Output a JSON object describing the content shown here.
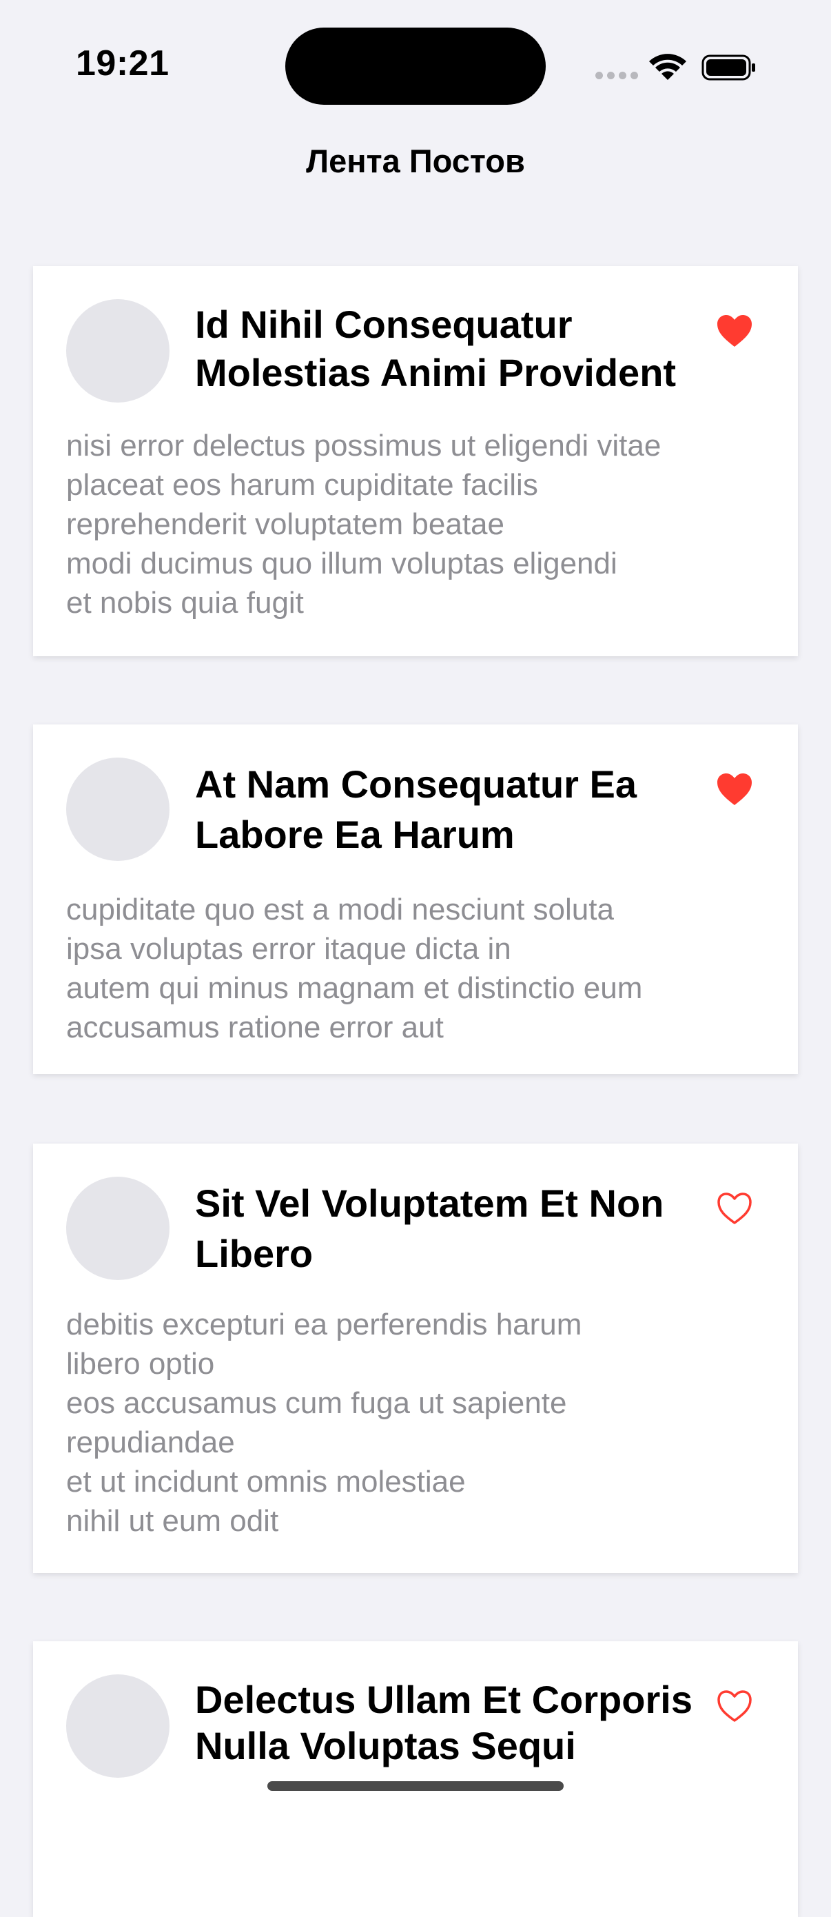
{
  "status_bar": {
    "time": "19:21"
  },
  "nav": {
    "title": "Лента Постов"
  },
  "colors": {
    "background": "#f2f2f7",
    "card": "#ffffff",
    "like_red": "#ff3b30",
    "body_text": "#8e8e93",
    "avatar": "#e5e5ea"
  },
  "posts": [
    {
      "title": "Id Nihil Consequatur Molestias Animi Provident",
      "body": "nisi error delectus possimus ut eligendi vitae\nplaceat eos harum cupiditate facilis\nreprehenderit voluptatem beatae\nmodi ducimus quo illum voluptas eligendi\net nobis quia fugit",
      "liked": true,
      "like_icon": "heart-filled-icon"
    },
    {
      "title": "At Nam Consequatur Ea Labore Ea Harum",
      "body": "cupiditate quo est a modi nesciunt soluta\nipsa voluptas error itaque dicta in\nautem qui minus magnam et distinctio eum\naccusamus ratione error aut",
      "liked": true,
      "like_icon": "heart-filled-icon"
    },
    {
      "title": "Sit Vel Voluptatem Et Non Libero",
      "body": "debitis excepturi ea perferendis harum\nlibero optio\neos accusamus cum fuga ut sapiente\nrepudiandae\net ut incidunt omnis molestiae\nnihil ut eum odit",
      "liked": false,
      "like_icon": "heart-outline-icon"
    },
    {
      "title": "Delectus Ullam Et Corporis Nulla Voluptas Sequi",
      "body": "",
      "liked": false,
      "like_icon": "heart-outline-icon"
    }
  ]
}
